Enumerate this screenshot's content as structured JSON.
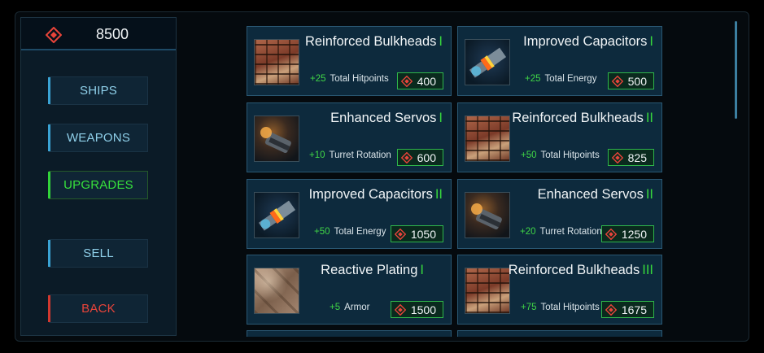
{
  "currency": {
    "amount": "8500",
    "icon": "gem-icon",
    "color": "#e8443a"
  },
  "nav": {
    "ships": "SHIPS",
    "weapons": "WEAPONS",
    "upgrades": "UPGRADES",
    "sell": "SELL",
    "back": "BACK"
  },
  "colors": {
    "accent_green": "#37d63d",
    "accent_blue": "#3aa3d4",
    "back_red": "#e8443a",
    "card_bg": "#0d2a3d"
  },
  "upgrades": [
    {
      "name": "Reinforced Bulkheads",
      "tier": "I",
      "bonus_value": "+25",
      "bonus_label": "Total Hitpoints",
      "price": "400",
      "icon": "bulkheads-icon"
    },
    {
      "name": "Improved Capacitors",
      "tier": "I",
      "bonus_value": "+25",
      "bonus_label": "Total Energy",
      "price": "500",
      "icon": "capacitor-icon"
    },
    {
      "name": "Enhanced Servos",
      "tier": "I",
      "bonus_value": "+10",
      "bonus_label": "Turret Rotation",
      "price": "600",
      "icon": "servo-icon"
    },
    {
      "name": "Reinforced Bulkheads",
      "tier": "II",
      "bonus_value": "+50",
      "bonus_label": "Total Hitpoints",
      "price": "825",
      "icon": "bulkheads-icon"
    },
    {
      "name": "Improved Capacitors",
      "tier": "II",
      "bonus_value": "+50",
      "bonus_label": "Total Energy",
      "price": "1050",
      "icon": "capacitor-icon"
    },
    {
      "name": "Enhanced Servos",
      "tier": "II",
      "bonus_value": "+20",
      "bonus_label": "Turret Rotation",
      "price": "1250",
      "icon": "servo-icon"
    },
    {
      "name": "Reactive Plating",
      "tier": "I",
      "bonus_value": "+5",
      "bonus_label": "Armor",
      "price": "1500",
      "icon": "plating-icon"
    },
    {
      "name": "Reinforced Bulkheads",
      "tier": "III",
      "bonus_value": "+75",
      "bonus_label": "Total Hitpoints",
      "price": "1675",
      "icon": "bulkheads-icon"
    }
  ]
}
